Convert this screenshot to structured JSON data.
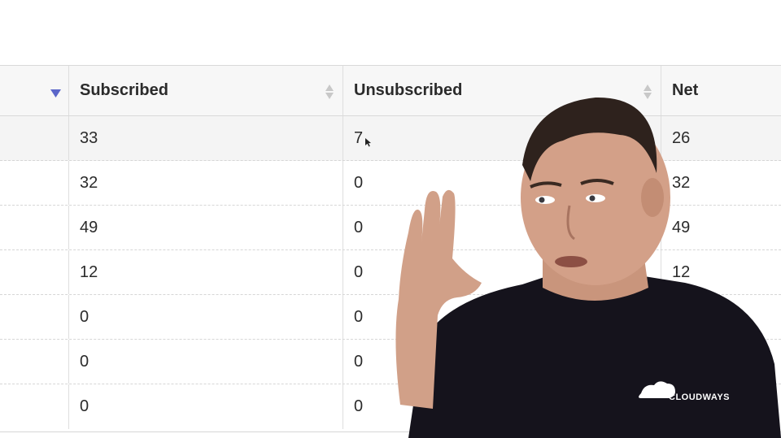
{
  "table": {
    "columns": [
      {
        "label": ""
      },
      {
        "label": "Subscribed"
      },
      {
        "label": "Unsubscribed"
      },
      {
        "label": "Net"
      }
    ],
    "rows": [
      {
        "subscribed": "33",
        "unsubscribed": "7",
        "net": "26"
      },
      {
        "subscribed": "32",
        "unsubscribed": "0",
        "net": "32"
      },
      {
        "subscribed": "49",
        "unsubscribed": "0",
        "net": "49"
      },
      {
        "subscribed": "12",
        "unsubscribed": "0",
        "net": "12"
      },
      {
        "subscribed": "0",
        "unsubscribed": "0",
        "net": ""
      },
      {
        "subscribed": "0",
        "unsubscribed": "0",
        "net": ""
      },
      {
        "subscribed": "0",
        "unsubscribed": "0",
        "net": ""
      }
    ]
  },
  "icons": {
    "first_column_header": "filter-down-triangle-icon",
    "sortable_columns": "sort-updown-icon"
  },
  "overlay": {
    "logo_text": "CLOUDWAYS"
  },
  "colors": {
    "filter_icon": "#5b66c9",
    "sort_icon": "#c4c4c4",
    "header_bg": "#f7f7f7",
    "text": "#2b2b2b"
  }
}
